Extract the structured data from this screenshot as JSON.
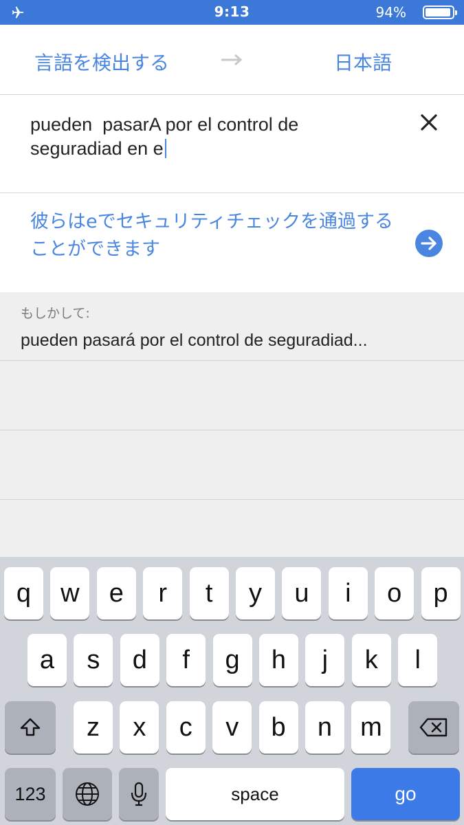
{
  "status_bar": {
    "time": "9:13",
    "battery_percent": "94%",
    "battery_level": 0.94,
    "airplane_icon": "airplane-icon"
  },
  "language_bar": {
    "source_language": "言語を検出する",
    "target_language": "日本語",
    "swap_icon": "right-arrow-icon"
  },
  "input": {
    "text": "pueden  pasarA por el control de seguradiad en e"
  },
  "translation": {
    "text": "彼らはeでセキュリティチェックを通過することができます"
  },
  "suggestion": {
    "label": "もしかして:",
    "text": "pueden  pasará por el control de seguradiad..."
  },
  "keyboard": {
    "row1": [
      "q",
      "w",
      "e",
      "r",
      "t",
      "y",
      "u",
      "i",
      "o",
      "p"
    ],
    "row2": [
      "a",
      "s",
      "d",
      "f",
      "g",
      "h",
      "j",
      "k",
      "l"
    ],
    "row3": [
      "z",
      "x",
      "c",
      "v",
      "b",
      "n",
      "m"
    ],
    "numbers_label": "123",
    "space_label": "space",
    "go_label": "go"
  },
  "colors": {
    "accent": "#4a86e0",
    "status_bar": "#3c78d8",
    "go_key": "#3c7be7"
  }
}
